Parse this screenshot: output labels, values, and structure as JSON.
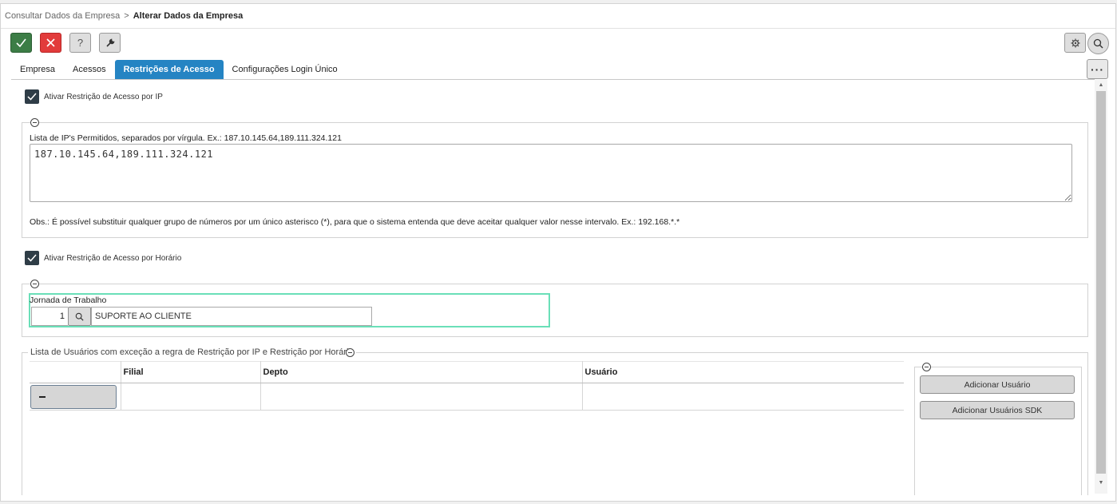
{
  "breadcrumb": {
    "parent": "Consultar Dados da Empresa",
    "separator": ">",
    "current": "Alterar Dados da Empresa"
  },
  "toolbar": {
    "confirm_icon": "check-icon",
    "cancel_icon": "close-icon",
    "help_label": "?",
    "tools_icon": "wrench-icon",
    "settings_icon": "gear-icon",
    "search_icon": "search-icon",
    "more_label": "···"
  },
  "tabs": [
    {
      "label": "Empresa",
      "active": false
    },
    {
      "label": "Acessos",
      "active": false
    },
    {
      "label": "Restrições de Acesso",
      "active": true
    },
    {
      "label": "Configurações Login Único",
      "active": false
    }
  ],
  "ip_restriction": {
    "checkbox_label": "Ativar Restrição de Acesso por IP",
    "checked": true,
    "list_label": "Lista de IP's Permitidos, separados por vírgula. Ex.: 187.10.145.64,189.111.324.121",
    "list_value": "187.10.145.64,189.111.324.121",
    "obs": "Obs.: É possível substituir qualquer grupo de números por um único asterisco (*), para que o sistema entenda que deve aceitar qualquer valor nesse intervalo. Ex.: 192.168.*.*"
  },
  "time_restriction": {
    "checkbox_label": "Ativar Restrição de Acesso por Horário",
    "checked": true,
    "jornada_label": "Jornada de Trabalho",
    "jornada_code": "1",
    "jornada_desc": "SUPORTE AO CLIENTE"
  },
  "exceptions": {
    "legend": "Lista de Usuários com exceção a regra de Restrição por IP e Restrição por Horário",
    "columns": [
      "",
      "Filial",
      "Depto",
      "Usuário"
    ],
    "rows": [
      {
        "filial": "",
        "depto": "",
        "usuario": ""
      }
    ],
    "add_user_label": "Adicionar Usuário",
    "add_sdk_label": "Adicionar Usuários SDK"
  },
  "colors": {
    "active_tab": "#2584c3",
    "confirm": "#3c7d46",
    "cancel": "#e23b3b",
    "focus_border": "#6adfb8"
  }
}
